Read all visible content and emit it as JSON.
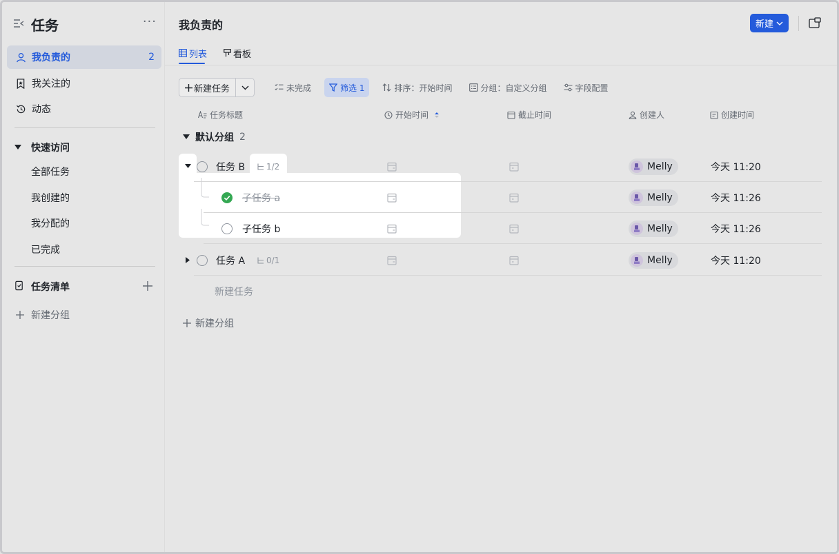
{
  "sidebar": {
    "title": "任务",
    "more": "···",
    "nav": [
      {
        "label": "我负责的",
        "count": "2"
      },
      {
        "label": "我关注的"
      },
      {
        "label": "动态"
      }
    ],
    "quick_access": {
      "label": "快速访问",
      "items": [
        "全部任务",
        "我创建的",
        "我分配的",
        "已完成"
      ]
    },
    "task_lists": {
      "label": "任务清单"
    },
    "new_group": "新建分组"
  },
  "header": {
    "title": "我负责的",
    "new_button": "新建"
  },
  "tabs": [
    {
      "label": "列表"
    },
    {
      "label": "看板"
    }
  ],
  "toolbar": {
    "new_task": "新建任务",
    "incomplete": "未完成",
    "filter": "筛选 1",
    "sort": "排序：开始时间",
    "group": "分组：自定义分组",
    "fields": "字段配置"
  },
  "columns": {
    "title": "任务标题",
    "start": "开始时间",
    "due": "截止时间",
    "creator": "创建人",
    "created": "创建时间"
  },
  "group": {
    "name": "默认分组",
    "count": "2"
  },
  "rows": [
    {
      "title": "任务 B",
      "subcount": "1/2",
      "creator": "Melly",
      "created": "今天 11:20"
    },
    {
      "title": "子任务 a",
      "creator": "Melly",
      "created": "今天 11:26"
    },
    {
      "title": "子任务 b",
      "creator": "Melly",
      "created": "今天 11:26"
    },
    {
      "title": "任务 A",
      "subcount": "0/1",
      "creator": "Melly",
      "created": "今天 11:20"
    }
  ],
  "add_task": "新建任务",
  "add_group": "新建分组",
  "colors": {
    "accent": "#245bdb",
    "done": "#34a853"
  }
}
